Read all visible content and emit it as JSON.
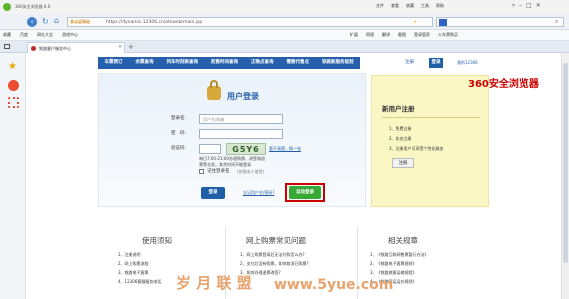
{
  "browser": {
    "title": "360安全浏览器 6.0",
    "menu": [
      "文件",
      "查看",
      "收藏",
      "工具",
      "帮助"
    ],
    "address_prefix": "非认证网站",
    "url": "https://dynamic.12306.cn/otsweb/main.jsp",
    "fav_items": [
      "收藏",
      "百度",
      "网址大全",
      "游戏中心"
    ],
    "toolbar_right": [
      "扩展",
      "网银",
      "翻译",
      "截图",
      "登录管家",
      "火车票购买"
    ],
    "tab_label": "铁路客户服务中心",
    "brand_label": "360安全浏览器"
  },
  "site": {
    "nav": [
      "车票预订",
      "余票查询",
      "列车时刻表查询",
      "起售时间查询",
      "正晚点查询",
      "需要代售点",
      "铁路新服务规划"
    ],
    "top_links": [
      "注册",
      "登录",
      "我的12306"
    ],
    "login": {
      "title": "用户登录",
      "username_label": "登录名:",
      "username_placeholder": "用户名/邮箱",
      "password_label": "密　码:",
      "captcha_label": "验证码:",
      "captcha_text": "G5Y6",
      "captcha_refresh": "看不清楚，换一张",
      "notice_line1": "每日7:00-23:00办理购票、改签和退",
      "notice_line2": "票等业务，其余时间不能登录",
      "remember_label": "记住登录名",
      "remember_note": "(仅限本人使用)",
      "login_button": "登录",
      "forgot_links": "忘记用户名/密码?",
      "auto_login_button": "自动登录"
    },
    "register": {
      "title": "新用户注册",
      "steps": [
        "1、免费注册",
        "2、实名注册",
        "3、注册用户可享受个性化服务"
      ],
      "button": "注册"
    },
    "bottom": [
      {
        "title": "使用须知",
        "items": [
          "1、注册说明",
          "2、网上购票流程",
          "3、铁路电子客票",
          "4、12306客服服务电话"
        ]
      },
      {
        "title": "网上购票常见问题",
        "items": [
          "1、网上购票登录后无法付款怎么办?",
          "2、支付后没有购票，如何取消已购票?",
          "3、如何办理退票改签?"
        ]
      },
      {
        "title": "相关规章",
        "items": [
          "1、《铁路互联网售票暂行办法》",
          "2、《铁路电子客票规则》",
          "3、《铁路旅客运输规程》",
          "4、《铁路客运运价规则》"
        ]
      }
    ]
  },
  "watermark": {
    "text": "岁 月 联 盟",
    "url": "www.5yue.com"
  },
  "colors": {
    "nav_blue": "#2660ad",
    "highlight": "#cc0000",
    "green_button": "#37a937",
    "register_bg": "#fbf7c4"
  }
}
